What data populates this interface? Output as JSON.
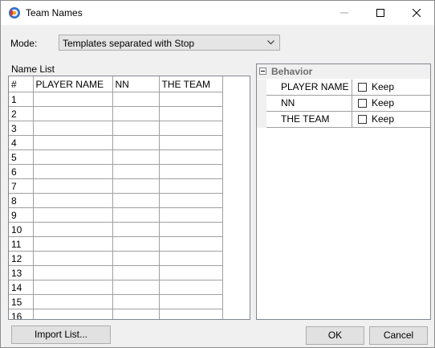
{
  "window": {
    "title": "Team Names",
    "minimize_icon": "minimize-icon",
    "maximize_icon": "maximize-icon",
    "close_icon": "close-icon"
  },
  "mode": {
    "label": "Mode:",
    "selected": "Templates separated with Stop"
  },
  "name_list": {
    "label": "Name List",
    "columns": [
      "#",
      "PLAYER NAME",
      "NN",
      "THE TEAM"
    ],
    "rows": [
      "1",
      "2",
      "3",
      "4",
      "5",
      "6",
      "7",
      "8",
      "9",
      "10",
      "11",
      "12",
      "13",
      "14",
      "15",
      "16"
    ]
  },
  "behavior": {
    "category": "Behavior",
    "rows": [
      {
        "name": "PLAYER NAME",
        "value": "Keep",
        "checked": false
      },
      {
        "name": "NN",
        "value": "Keep",
        "checked": false
      },
      {
        "name": "THE TEAM",
        "value": "Keep",
        "checked": false
      }
    ]
  },
  "buttons": {
    "import": "Import List...",
    "ok": "OK",
    "cancel": "Cancel"
  },
  "colors": {
    "window_bg": "#f0f0f0",
    "button_bg": "#e1e1e1",
    "grid_line": "#a0a0a0"
  }
}
